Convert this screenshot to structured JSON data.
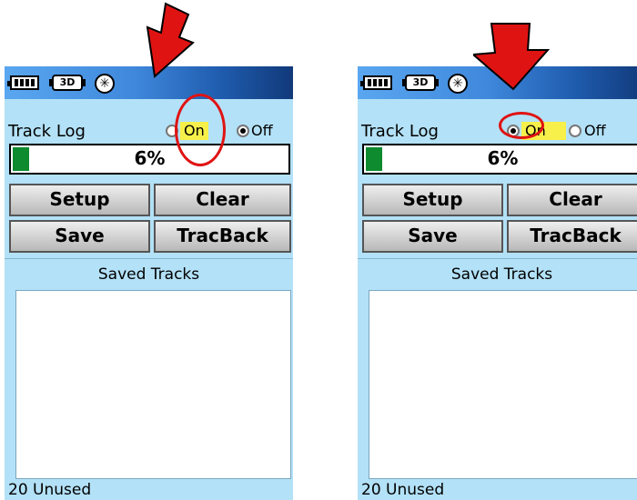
{
  "screens": [
    {
      "status": {
        "gps_mode": "3D"
      },
      "track_log_label": "Track Log",
      "option_on": "On",
      "option_off": "Off",
      "selected": "Off",
      "progress": {
        "percent_text": "6%",
        "value": 0.06
      },
      "buttons": {
        "setup": "Setup",
        "clear": "Clear",
        "save": "Save",
        "tracback": "TracBack"
      },
      "saved_tracks_title": "Saved Tracks",
      "unused_text": "20 Unused"
    },
    {
      "status": {
        "gps_mode": "3D"
      },
      "track_log_label": "Track Log",
      "option_on": "On",
      "option_off": "Off",
      "selected": "On",
      "progress": {
        "percent_text": "6%",
        "value": 0.06
      },
      "buttons": {
        "setup": "Setup",
        "clear": "Clear",
        "save": "Save",
        "tracback": "TracBack"
      },
      "saved_tracks_title": "Saved Tracks",
      "unused_text": "20 Unused"
    }
  ],
  "annotation": {
    "arrow_color": "#e01313",
    "circle_color": "#e01313",
    "highlight_color": "#f7f04a"
  },
  "icons": [
    "battery-icon",
    "gps-3d-icon",
    "compass-icon",
    "red-arrow-icon"
  ]
}
